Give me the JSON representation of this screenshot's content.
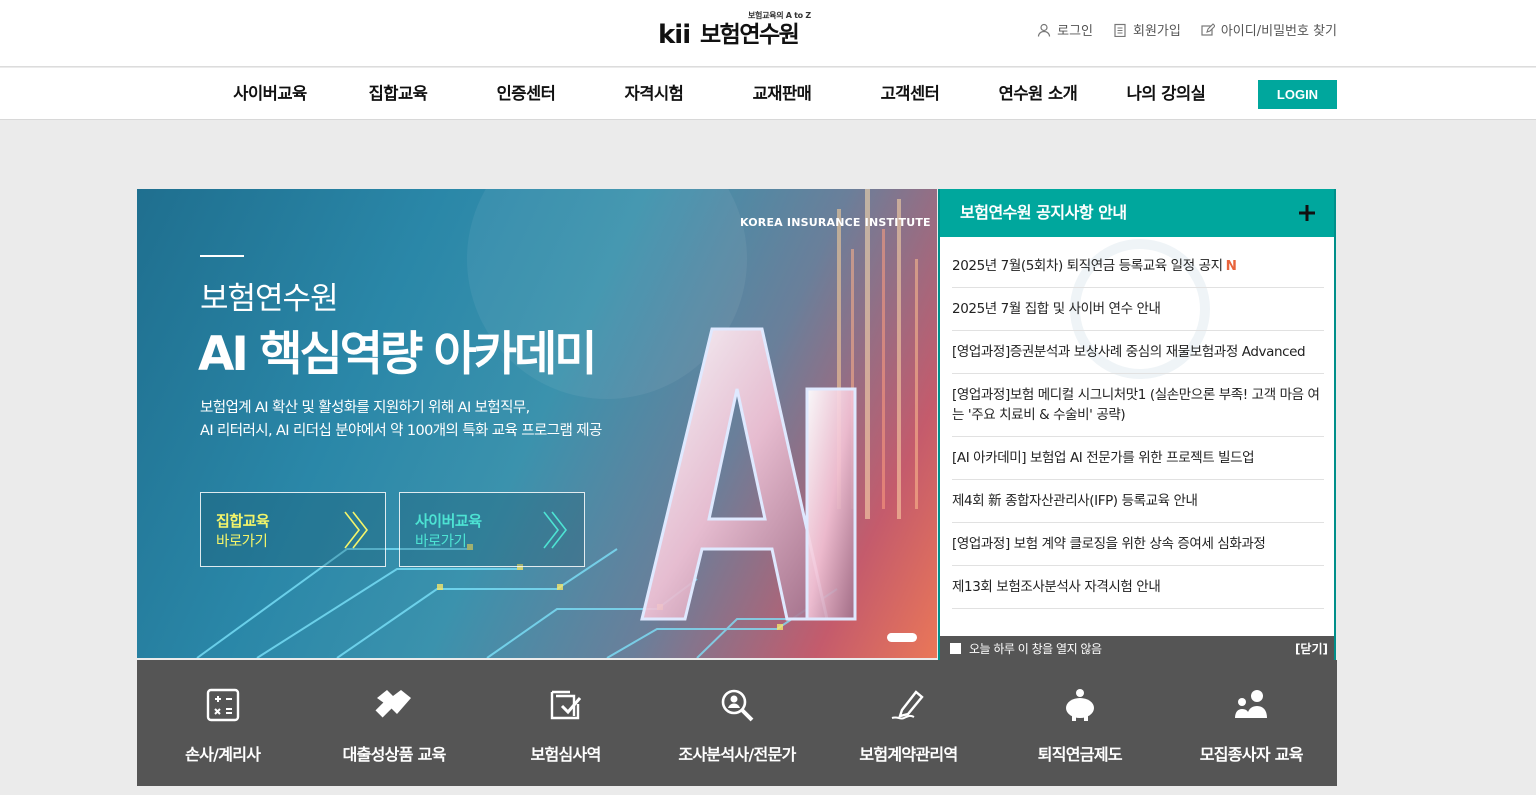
{
  "header": {
    "logo_tagline": "보험교육의 A to Z",
    "logo_mark": "kii",
    "logo_name": "보험연수원",
    "util": [
      {
        "label": "로그인",
        "icon": "user-icon"
      },
      {
        "label": "회원가입",
        "icon": "clipboard-icon"
      },
      {
        "label": "아이디/비밀번호 찾기",
        "icon": "edit-icon"
      }
    ]
  },
  "nav": {
    "items": [
      "사이버교육",
      "집합교육",
      "인증센터",
      "자격시험",
      "교재판매",
      "고객센터",
      "연수원 소개",
      "나의 강의실"
    ],
    "login_label": "LOGIN"
  },
  "banner": {
    "subtitle": "보험연수원",
    "title": "AI 핵심역량 아카데미",
    "desc_line1": "보험업계 AI 확산 및 활성화를 지원하기 위해 AI 보험직무,",
    "desc_line2": "AI 리터러시, AI 리더십 분야에서 약 100개의 특화 교육 프로그램 제공",
    "institute": "KOREA INSURANCE INSTITUTE",
    "graphic_text": "AI",
    "btn1": {
      "title": "집합교육",
      "sub": "바로가기",
      "color": "#f4f56a"
    },
    "btn2": {
      "title": "사이버교육",
      "sub": "바로가기",
      "color": "#4de3d3"
    }
  },
  "notice": {
    "title": "보험연수원 공지사항 안내",
    "items": [
      {
        "text": "2025년 7월(5회차) 퇴직연금 등록교육 일정 공지",
        "badge": "N"
      },
      {
        "text": "2025년 7월 집합 및 사이버 연수 안내",
        "badge": ""
      },
      {
        "text": "[영업과정]증권분석과 보상사례 중심의 재물보험과정 Advanced",
        "badge": ""
      },
      {
        "text": "[영업과정]보험 메디컬 시그니처맛1 (실손만으론 부족! 고객 마음 여는 '주요 치료비 & 수술비' 공략)",
        "badge": ""
      },
      {
        "text": "[AI 아카데미] 보험업 AI 전문가를 위한 프로젝트 빌드업",
        "badge": ""
      },
      {
        "text": "제4회 新 종합자산관리사(IFP) 등록교육 안내",
        "badge": ""
      },
      {
        "text": "[영업과정] 보험 계약 클로징을 위한 상속 증여세 심화과정",
        "badge": ""
      },
      {
        "text": "제13회 보험조사분석사 자격시험 안내",
        "badge": ""
      }
    ],
    "dont_show": "오늘 하루 이 창을 열지 않음",
    "close": "[닫기]"
  },
  "quick": [
    {
      "label": "손사/계리사",
      "icon": "calculator-icon"
    },
    {
      "label": "대출성상품 교육",
      "icon": "handshake-icon"
    },
    {
      "label": "보험심사역",
      "icon": "checklist-icon"
    },
    {
      "label": "조사분석사/전문가",
      "icon": "magnifier-person-icon"
    },
    {
      "label": "보험계약관리역",
      "icon": "pen-sign-icon"
    },
    {
      "label": "퇴직연금제도",
      "icon": "piggy-bank-icon"
    },
    {
      "label": "모집종사자 교육",
      "icon": "people-icon"
    }
  ],
  "colors": {
    "accent": "#00a79d",
    "quick_bg": "#555555",
    "new_badge": "#e8643c"
  }
}
